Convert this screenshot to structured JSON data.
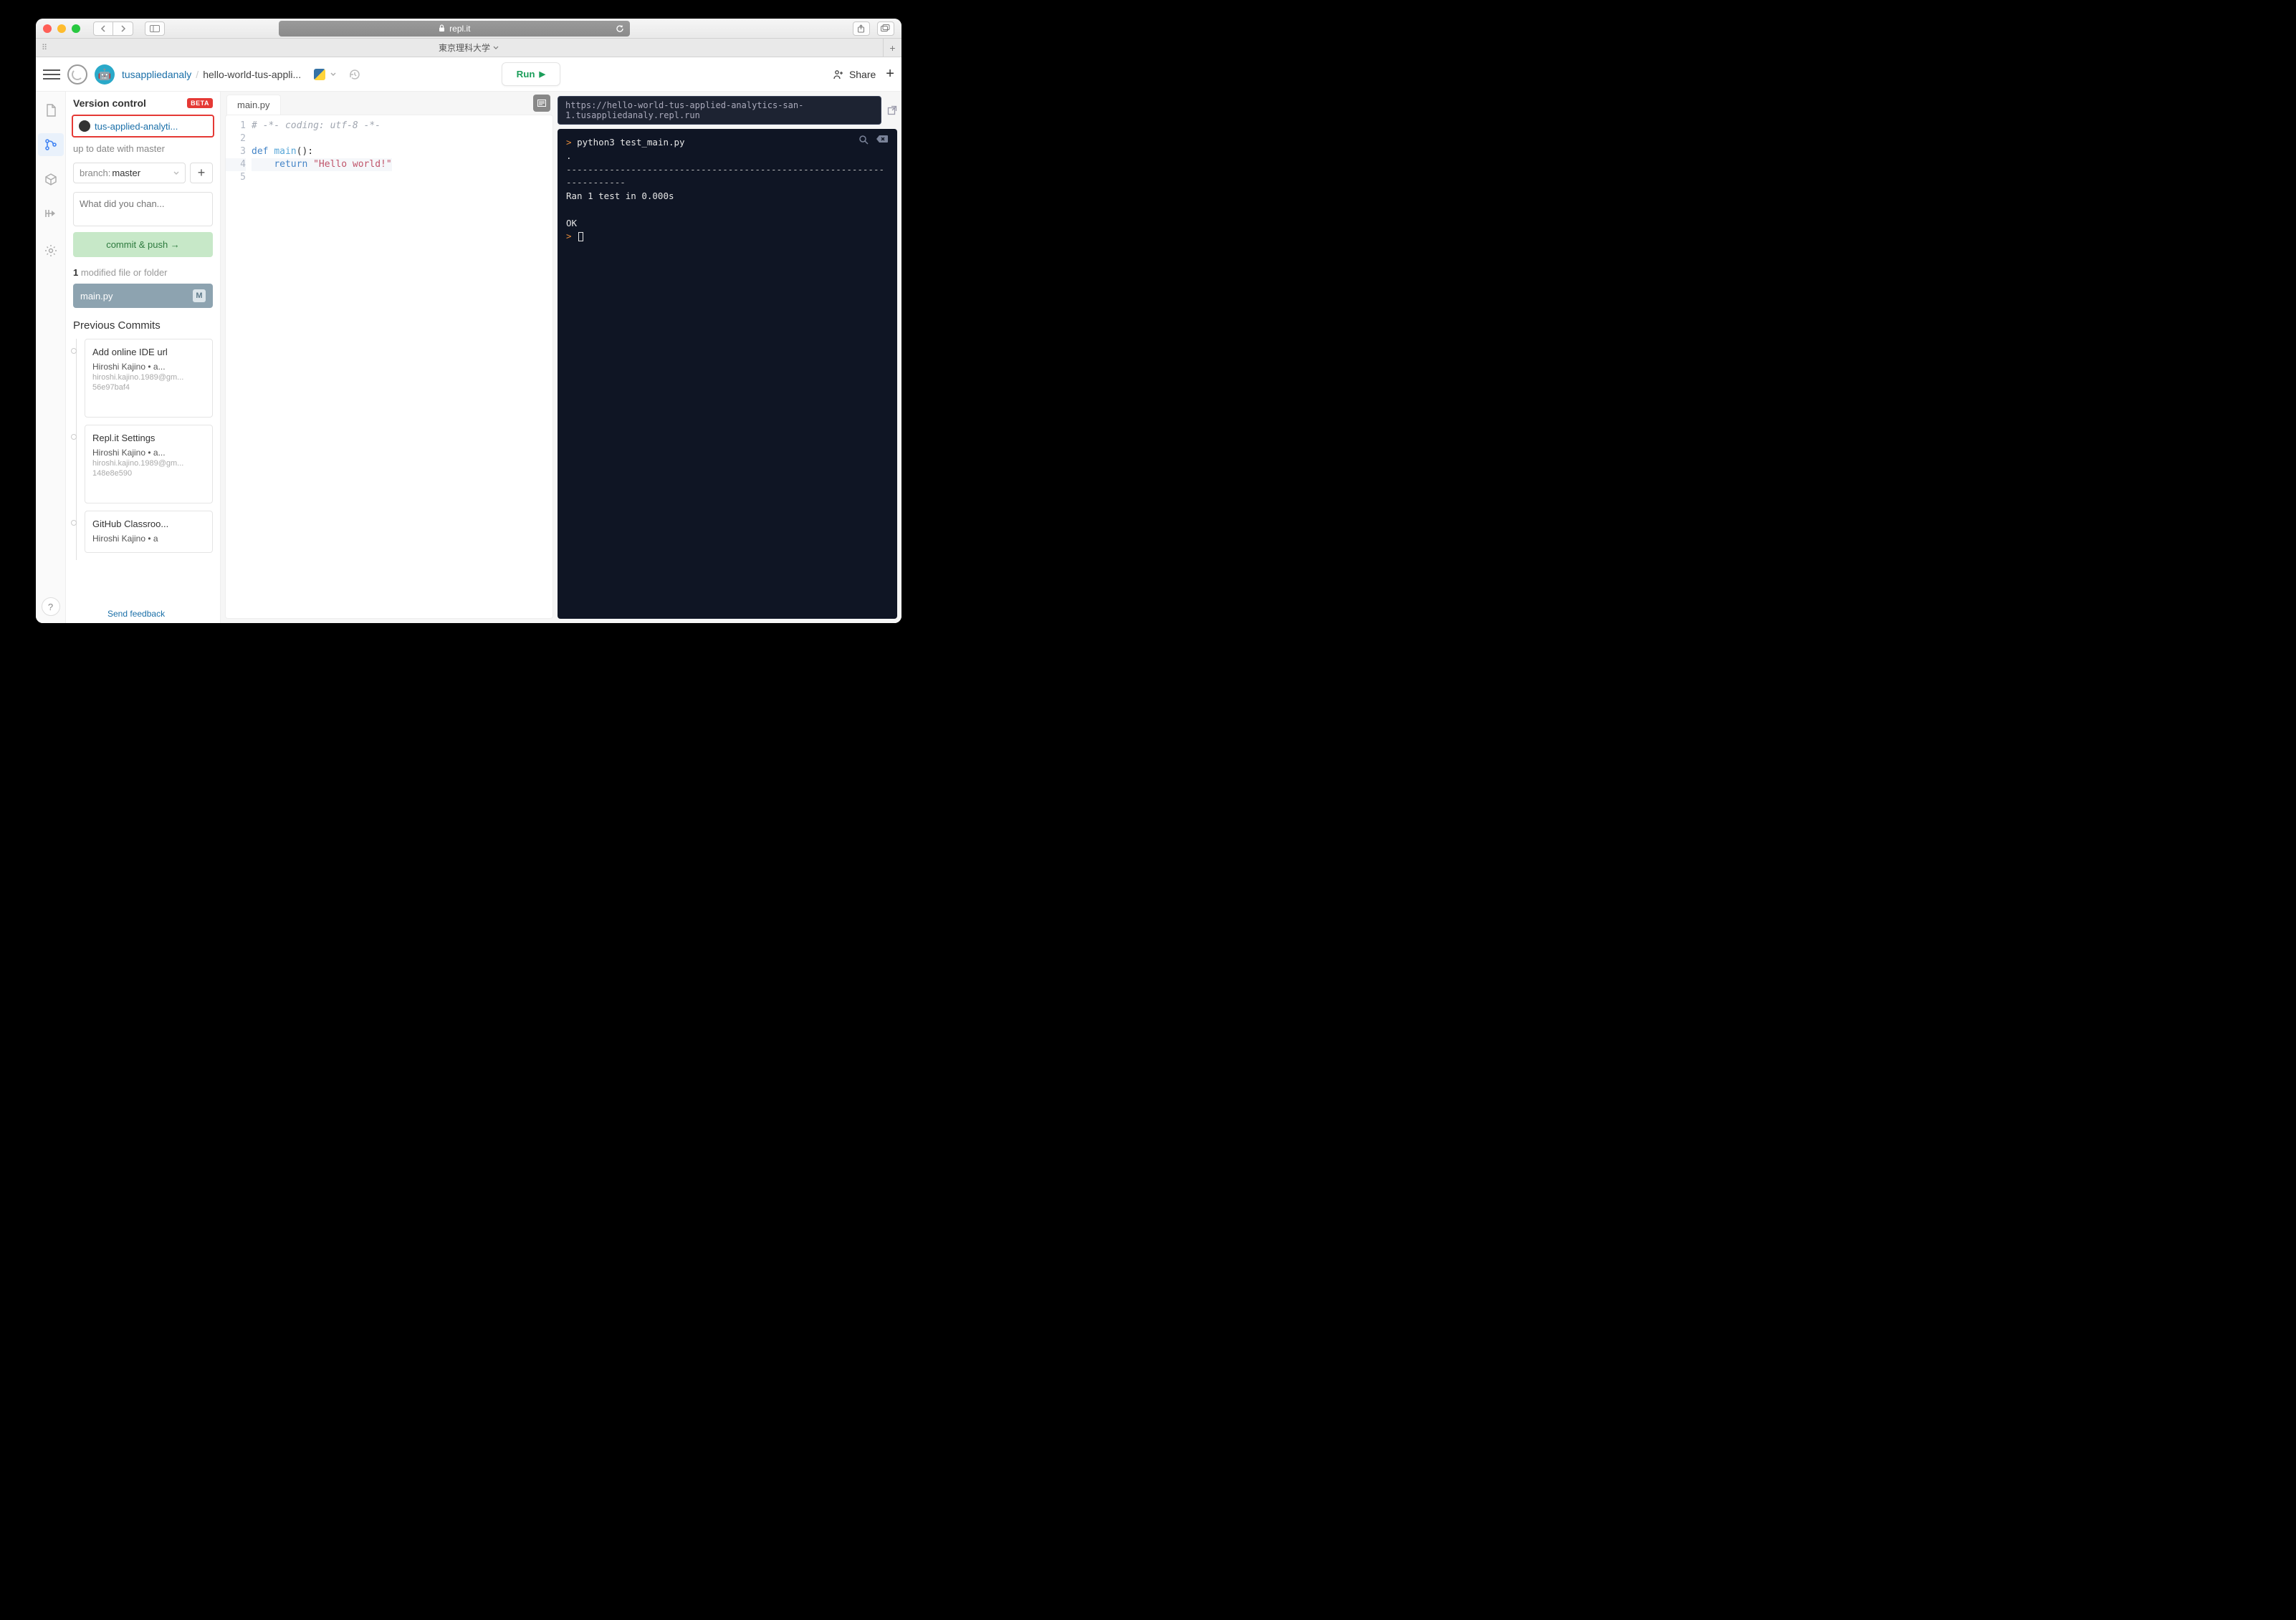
{
  "safari": {
    "url_host": "repl.it",
    "tab_label": "東京理科大学"
  },
  "header": {
    "owner": "tusappliedanaly",
    "repl_name": "hello-world-tus-appli...",
    "run_label": "Run",
    "share_label": "Share"
  },
  "vc": {
    "title": "Version control",
    "beta": "BETA",
    "repo_link": "tus-applied-analyti...",
    "status": "up to date with master",
    "branch_prefix": "branch:",
    "branch_name": " master",
    "commit_placeholder": "What did you chan...",
    "commit_button": "commit & push →",
    "modified_count": "1",
    "modified_label": " modified file or folder",
    "modified_file": "main.py",
    "modified_badge": "M",
    "previous_title": "Previous Commits",
    "commits": [
      {
        "title": "Add online IDE url",
        "author": "Hiroshi Kajino • a...",
        "email": "hiroshi.kajino.1989@gm...",
        "hash": "56e97baf4"
      },
      {
        "title": "Repl.it Settings",
        "author": "Hiroshi Kajino • a...",
        "email": "hiroshi.kajino.1989@gm...",
        "hash": "148e8e590"
      },
      {
        "title": "GitHub Classroo...",
        "author": "Hiroshi Kajino • a",
        "email": "",
        "hash": ""
      }
    ]
  },
  "feedback_label": "Send feedback",
  "editor": {
    "tab": "main.py",
    "lines": [
      {
        "n": "1",
        "comment": "# -*- coding: utf-8 -*-"
      },
      {
        "n": "2",
        "plain": ""
      },
      {
        "n": "3",
        "kw": "def ",
        "fn": "main",
        "rest": "():"
      },
      {
        "n": "4",
        "indent": "    ",
        "kw2": "return ",
        "str": "\"Hello world!\""
      },
      {
        "n": "5",
        "plain": ""
      }
    ]
  },
  "terminal": {
    "url": "https://hello-world-tus-applied-analytics-san-1.tusappliedanaly.repl.run",
    "cmd": "python3 test_main.py",
    "dot": ".",
    "dash_line": "----------------------------------------------------------------------",
    "ran": "Ran 1 test in 0.000s",
    "ok": "OK"
  }
}
